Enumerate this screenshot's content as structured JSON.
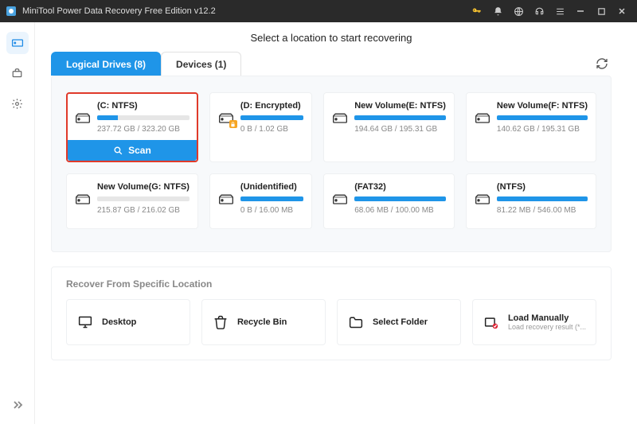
{
  "window": {
    "title": "MiniTool Power Data Recovery Free Edition v12.2"
  },
  "page": {
    "heading": "Select a location to start recovering"
  },
  "tabs": {
    "logical": "Logical Drives (8)",
    "devices": "Devices (1)"
  },
  "scan_label": "Scan",
  "drives": [
    {
      "name": "(C: NTFS)",
      "size": "237.72 GB / 323.20 GB",
      "fill": 22,
      "selected": true,
      "locked": false
    },
    {
      "name": "(D: Encrypted)",
      "size": "0 B / 1.02 GB",
      "fill": 100,
      "selected": false,
      "locked": true
    },
    {
      "name": "New Volume(E: NTFS)",
      "size": "194.64 GB / 195.31 GB",
      "fill": 100,
      "selected": false,
      "locked": false
    },
    {
      "name": "New Volume(F: NTFS)",
      "size": "140.62 GB / 195.31 GB",
      "fill": 100,
      "selected": false,
      "locked": false
    },
    {
      "name": "New Volume(G: NTFS)",
      "size": "215.87 GB / 216.02 GB",
      "fill": 0,
      "selected": false,
      "locked": false
    },
    {
      "name": "(Unidentified)",
      "size": "0 B / 16.00 MB",
      "fill": 100,
      "selected": false,
      "locked": false
    },
    {
      "name": "(FAT32)",
      "size": "68.06 MB / 100.00 MB",
      "fill": 100,
      "selected": false,
      "locked": false
    },
    {
      "name": "(NTFS)",
      "size": "81.22 MB / 546.00 MB",
      "fill": 100,
      "selected": false,
      "locked": false
    }
  ],
  "specific": {
    "title": "Recover From Specific Location",
    "items": [
      {
        "label": "Desktop",
        "icon": "desktop",
        "sub": ""
      },
      {
        "label": "Recycle Bin",
        "icon": "recycle",
        "sub": ""
      },
      {
        "label": "Select Folder",
        "icon": "folder",
        "sub": ""
      },
      {
        "label": "Load Manually",
        "icon": "load",
        "sub": "Load recovery result (*..."
      }
    ]
  }
}
